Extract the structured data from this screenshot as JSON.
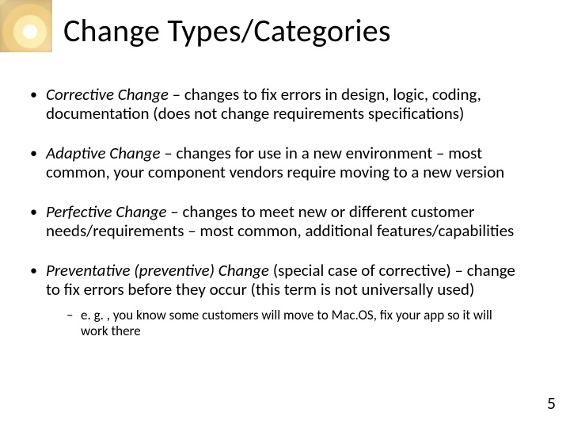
{
  "title": "Change Types/Categories",
  "bullets": [
    {
      "term": "Corrective Change",
      "rest": " – changes to fix errors in design, logic, coding, documentation (does not change requirements specifications)"
    },
    {
      "term": "Adaptive Change",
      "rest": " – changes for use in a new environment – most common, your component vendors require moving to a new version"
    },
    {
      "term": "Perfective Change",
      "rest": " – changes to meet new or different customer needs/requirements – most common, additional features/capabilities"
    },
    {
      "term": "Preventative (preventive) Change",
      "rest": " (special case of corrective) – change to fix errors before they occur (this term is not universally used)",
      "sub": "e. g. , you know some customers will move to Mac.OS, fix your app so it will work there"
    }
  ],
  "page_number": "5"
}
